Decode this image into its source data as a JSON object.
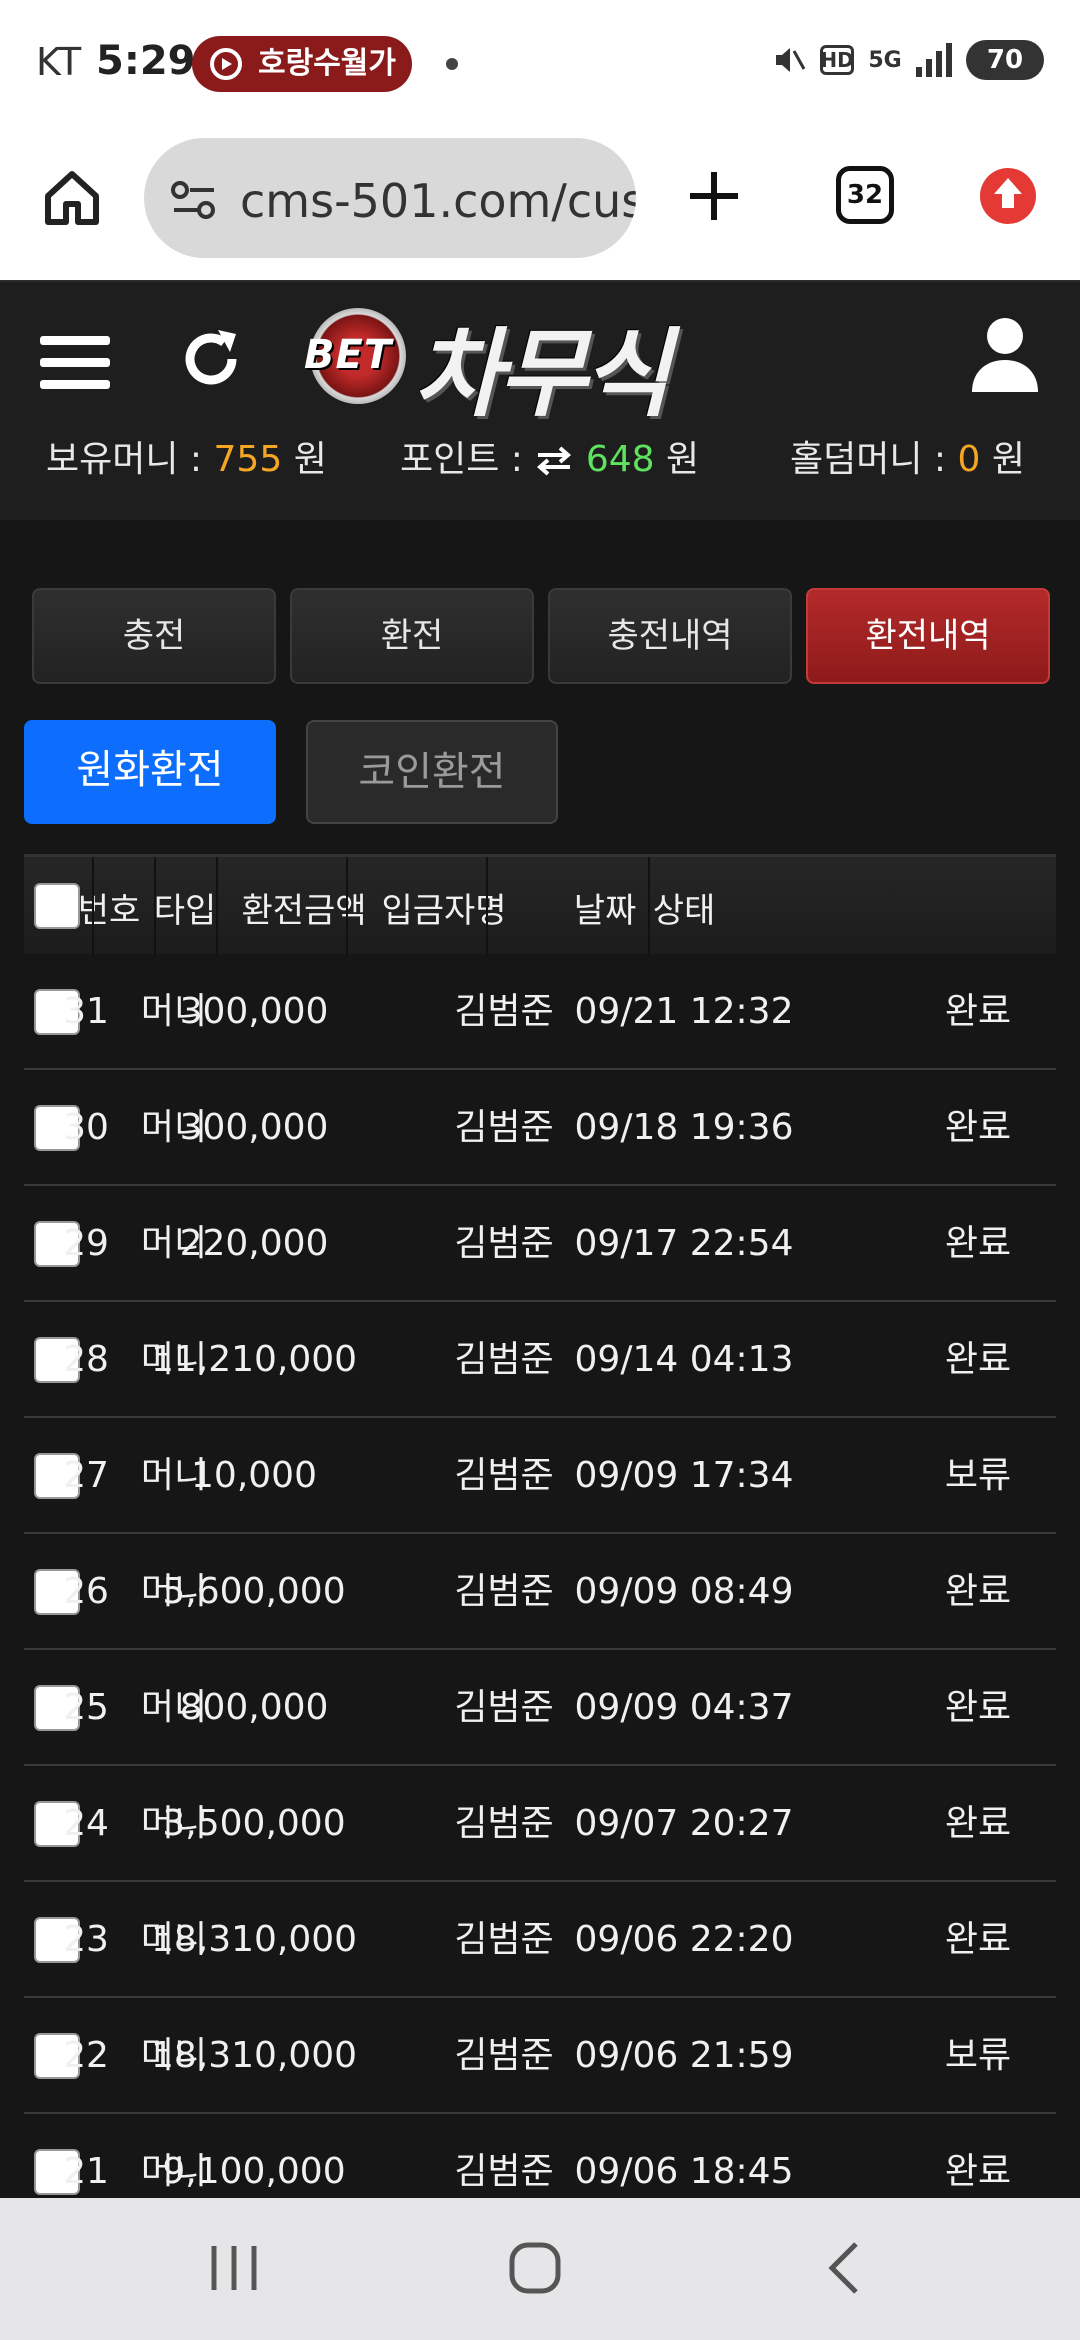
{
  "status_bar": {
    "carrier": "KT",
    "time": "5:29",
    "notification": "호랑수월가",
    "hd_label": "HD",
    "network_label": "5G",
    "battery": "70"
  },
  "browser": {
    "url": "cms-501.com/cus",
    "tab_count": "32"
  },
  "site": {
    "logo_prefix": "BET",
    "logo_name": "차무식"
  },
  "balances": {
    "holding_label": "보유머니 :",
    "holding_value": "755",
    "point_label": "포인트 :",
    "point_value": "648",
    "holdem_label": "홀덤머니 :",
    "holdem_value": "0",
    "unit": "원"
  },
  "tabs": [
    {
      "label": "충전",
      "active": false
    },
    {
      "label": "환전",
      "active": false
    },
    {
      "label": "충전내역",
      "active": false
    },
    {
      "label": "환전내역",
      "active": true
    }
  ],
  "sub_tabs": {
    "won": "원화환전",
    "coin": "코인환전"
  },
  "table": {
    "headers": [
      "번호",
      "타입",
      "환전금액",
      "입금자명",
      "날짜",
      "상태"
    ],
    "rows": [
      {
        "no": "31",
        "type": "머니",
        "amount": "300,000",
        "name": "김범준",
        "date": "09/21 12:32",
        "status": "완료"
      },
      {
        "no": "30",
        "type": "머니",
        "amount": "300,000",
        "name": "김범준",
        "date": "09/18 19:36",
        "status": "완료"
      },
      {
        "no": "29",
        "type": "머니",
        "amount": "220,000",
        "name": "김범준",
        "date": "09/17 22:54",
        "status": "완료"
      },
      {
        "no": "28",
        "type": "머니",
        "amount": "11,210,000",
        "name": "김범준",
        "date": "09/14 04:13",
        "status": "완료"
      },
      {
        "no": "27",
        "type": "머니",
        "amount": "10,000",
        "name": "김범준",
        "date": "09/09 17:34",
        "status": "보류"
      },
      {
        "no": "26",
        "type": "머니",
        "amount": "5,600,000",
        "name": "김범준",
        "date": "09/09 08:49",
        "status": "완료"
      },
      {
        "no": "25",
        "type": "머니",
        "amount": "800,000",
        "name": "김범준",
        "date": "09/09 04:37",
        "status": "완료"
      },
      {
        "no": "24",
        "type": "머니",
        "amount": "3,500,000",
        "name": "김범준",
        "date": "09/07 20:27",
        "status": "완료"
      },
      {
        "no": "23",
        "type": "머니",
        "amount": "18,310,000",
        "name": "김범준",
        "date": "09/06 22:20",
        "status": "완료"
      },
      {
        "no": "22",
        "type": "머니",
        "amount": "18,310,000",
        "name": "김범준",
        "date": "09/06 21:59",
        "status": "보류"
      },
      {
        "no": "21",
        "type": "머니",
        "amount": "9,100,000",
        "name": "김범준",
        "date": "09/06 18:45",
        "status": "완료"
      }
    ]
  },
  "icons": {
    "home": "home-icon",
    "site_settings": "tune-icon",
    "new_tab": "plus-icon",
    "update": "arrow-up-icon",
    "menu": "hamburger-icon",
    "refresh": "refresh-icon",
    "user": "user-icon",
    "point_transfer": "swap-arrows-icon",
    "nav_recent": "recent-apps-icon",
    "nav_home": "home-circle-icon",
    "nav_back": "back-icon"
  },
  "colors": {
    "active_tab": "#a32222",
    "primary_button": "#0d6efd",
    "balance_accent": "#f5a623",
    "point_accent": "#5de35d"
  }
}
